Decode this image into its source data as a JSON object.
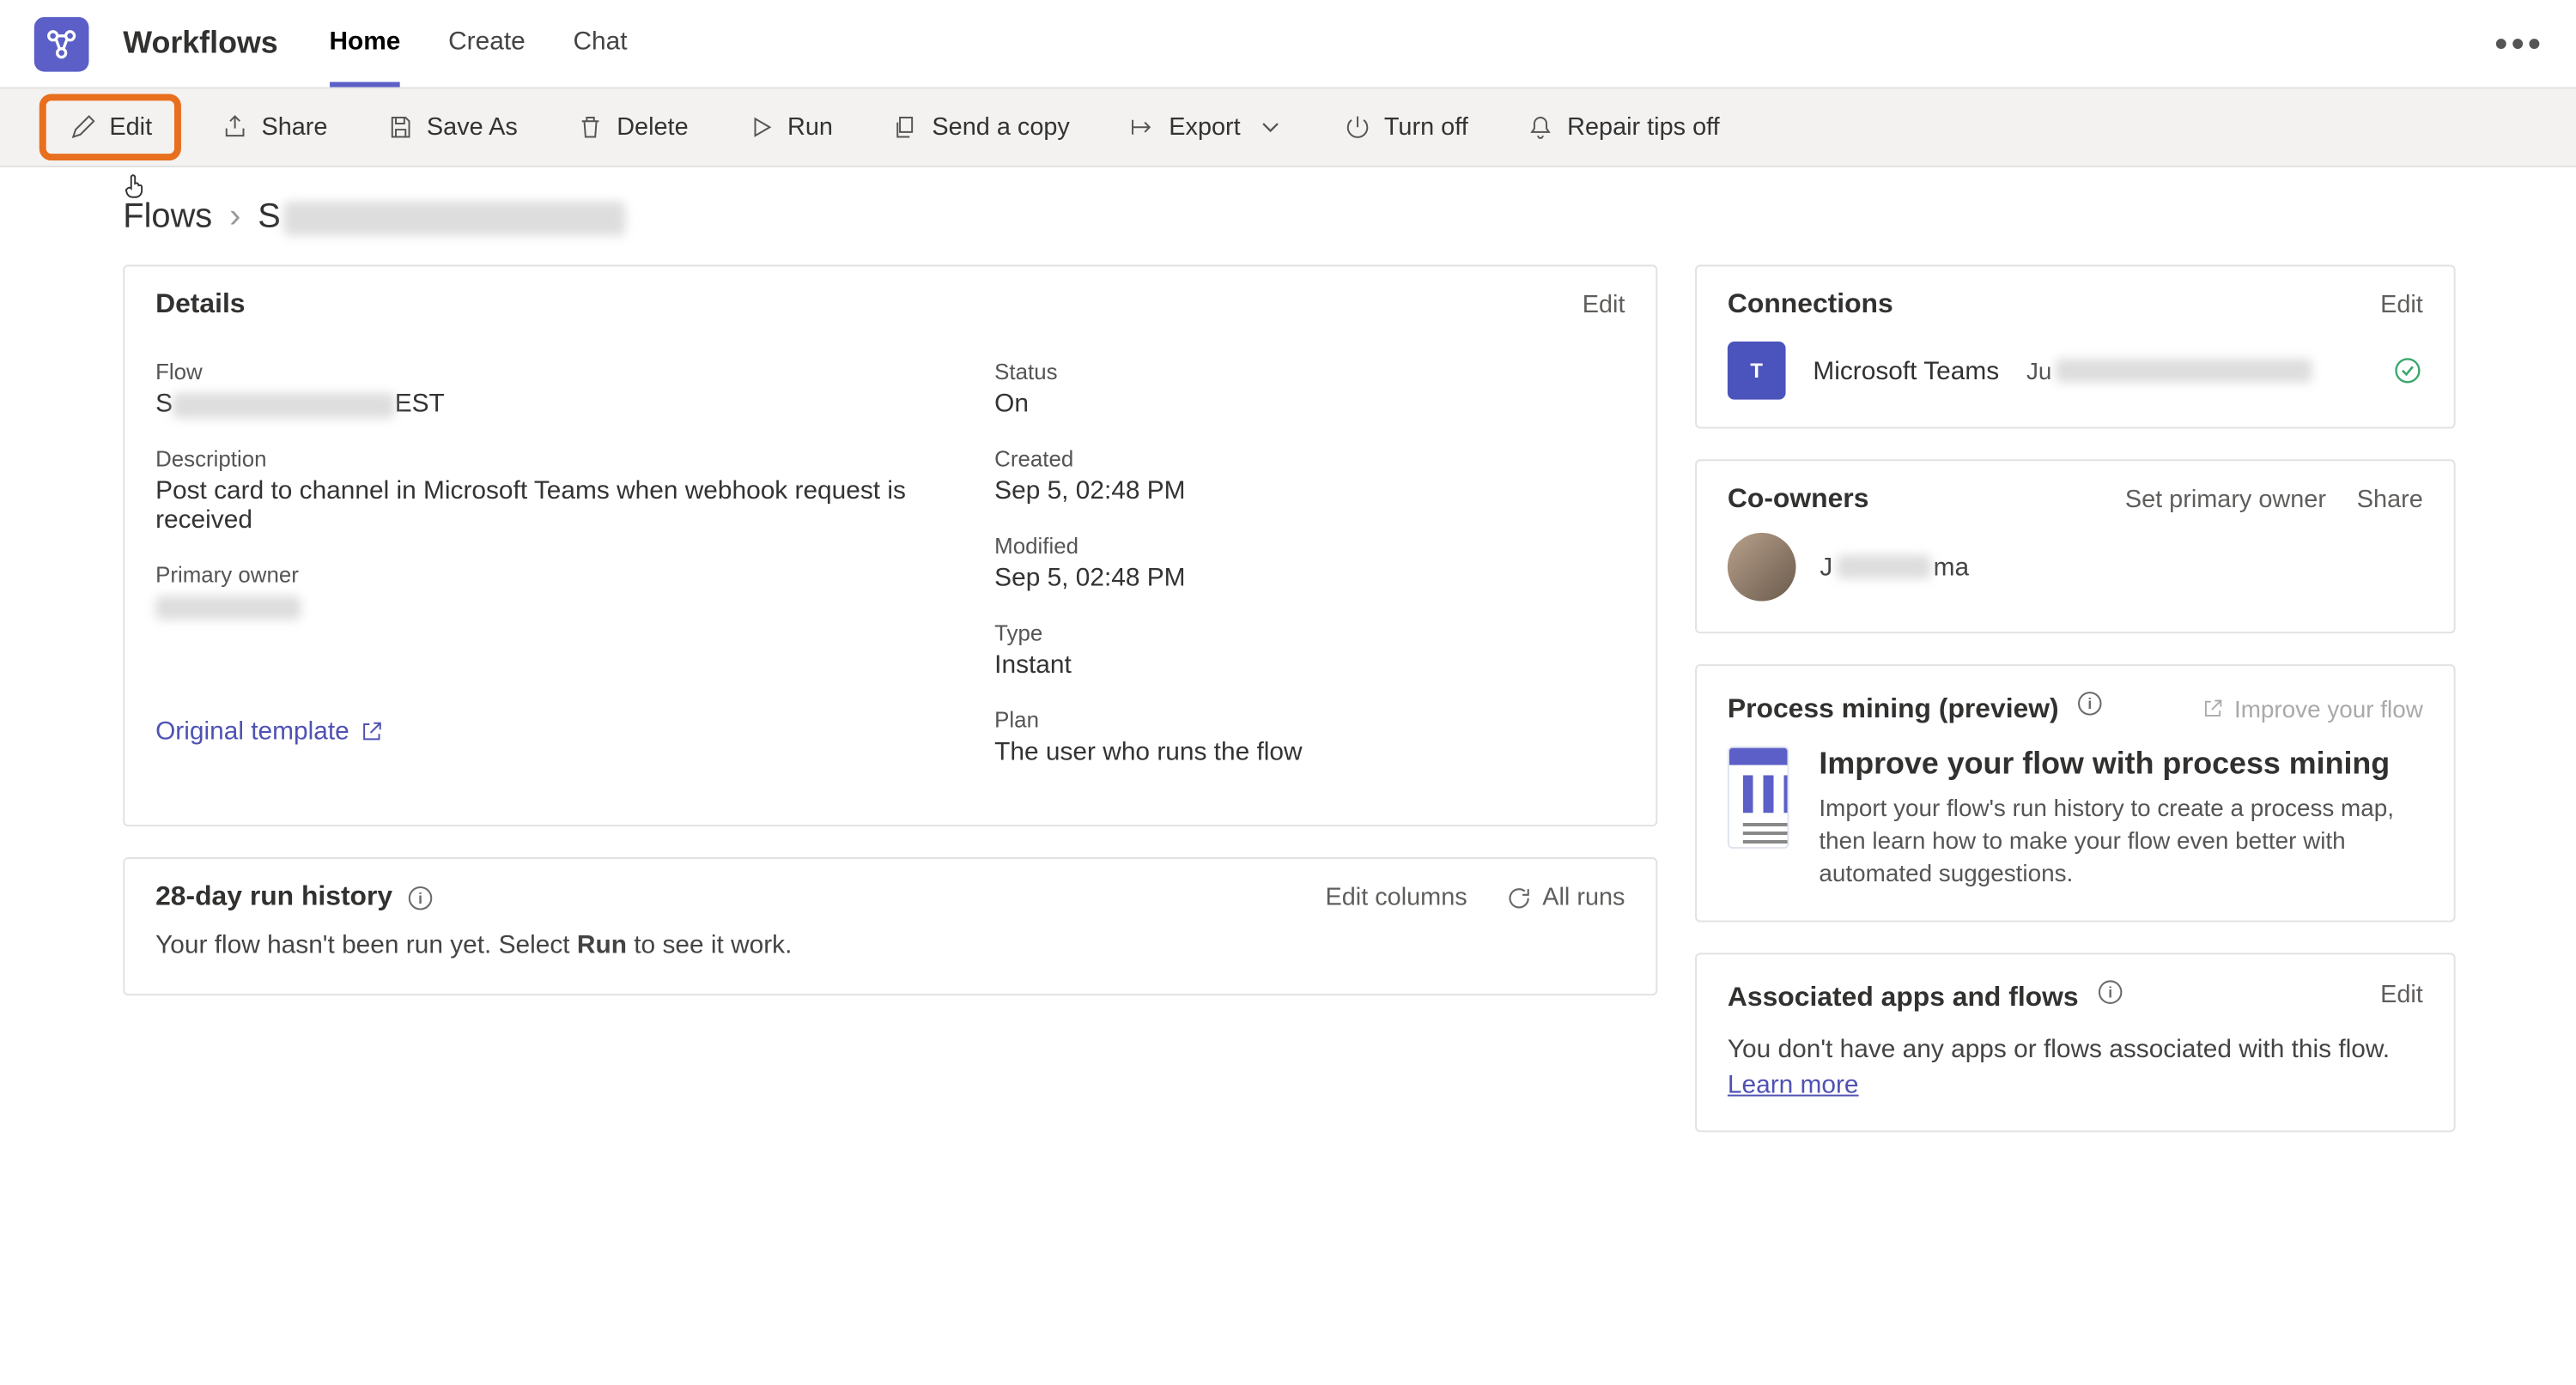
{
  "header": {
    "brand": "Workflows",
    "tabs": [
      {
        "label": "Home",
        "active": true
      },
      {
        "label": "Create",
        "active": false
      },
      {
        "label": "Chat",
        "active": false
      }
    ]
  },
  "toolbar": {
    "edit": "Edit",
    "share": "Share",
    "save_as": "Save As",
    "delete": "Delete",
    "run": "Run",
    "send_copy": "Send a copy",
    "export": "Export",
    "turn_off": "Turn off",
    "repair_tips_off": "Repair tips off"
  },
  "breadcrumb": {
    "root": "Flows",
    "current_prefix": "S"
  },
  "details": {
    "title": "Details",
    "edit_label": "Edit",
    "flow_label": "Flow",
    "flow_value_prefix": "S",
    "flow_value_suffix": "EST",
    "description_label": "Description",
    "description_value": "Post card to channel in Microsoft Teams when webhook request is received",
    "primary_owner_label": "Primary owner",
    "status_label": "Status",
    "status_value": "On",
    "created_label": "Created",
    "created_value": "Sep 5, 02:48 PM",
    "modified_label": "Modified",
    "modified_value": "Sep 5, 02:48 PM",
    "type_label": "Type",
    "type_value": "Instant",
    "plan_label": "Plan",
    "plan_value": "The user who runs the flow",
    "original_template": "Original template"
  },
  "run_history": {
    "title": "28-day run history",
    "edit_columns": "Edit columns",
    "all_runs": "All runs",
    "message_pre": "Your flow hasn't been run yet. Select ",
    "message_bold": "Run",
    "message_post": " to see it work."
  },
  "connections": {
    "title": "Connections",
    "edit": "Edit",
    "items": [
      {
        "name": "Microsoft Teams",
        "account_prefix": "Ju"
      }
    ]
  },
  "coowners": {
    "title": "Co-owners",
    "set_primary": "Set primary owner",
    "share": "Share",
    "owner_name_prefix": "J",
    "owner_name_suffix": "ma"
  },
  "process_mining": {
    "title": "Process mining (preview)",
    "improve_link": "Improve your flow",
    "headline": "Improve your flow with process mining",
    "desc": "Import your flow's run history to create a process map, then learn how to make your flow even better with automated suggestions."
  },
  "associated": {
    "title": "Associated apps and flows",
    "edit": "Edit",
    "message": "You don't have any apps or flows associated with this flow.",
    "learn_more": "Learn more"
  }
}
